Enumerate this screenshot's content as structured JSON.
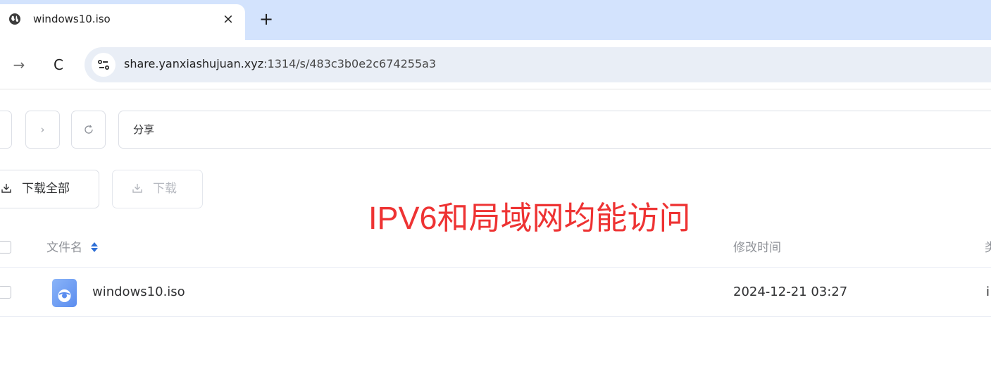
{
  "browser": {
    "tab_title": "windows10.iso",
    "close_glyph": "×",
    "new_tab_glyph": "+",
    "forward_glyph": "→",
    "reload_glyph": "C",
    "url_host": "share.yanxiashujuan.xyz",
    "url_rest": ":1314/s/483c3b0e2c674255a3"
  },
  "nav": {
    "forward_glyph": "›",
    "path": "分享"
  },
  "actions": {
    "download_all": "下载全部",
    "download": "下载"
  },
  "overlay_text": "IPV6和局域网均能访问",
  "table": {
    "columns": {
      "name": "文件名",
      "modified": "修改时间",
      "type": "类"
    },
    "rows": [
      {
        "name": "windows10.iso",
        "modified": "2024-12-21 03:27",
        "type": "i"
      }
    ]
  },
  "colors": {
    "tabstrip": "#d3e3fd",
    "overlay": "#ee3333",
    "accent": "#409eff"
  }
}
